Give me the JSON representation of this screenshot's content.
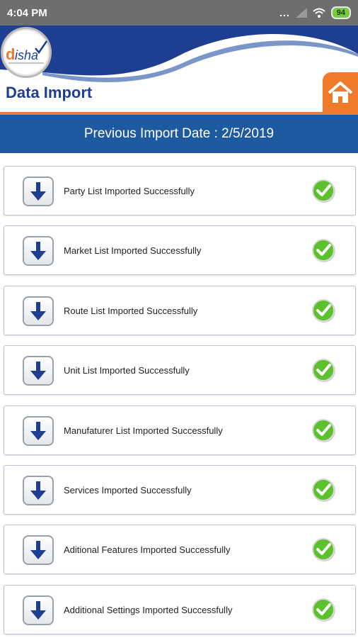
{
  "status_bar": {
    "time": "4:04 PM",
    "dots": "...",
    "battery": "94"
  },
  "header": {
    "logo_text": "disha",
    "title": "Data Import"
  },
  "banner": {
    "text": "Previous Import Date : 2/5/2019"
  },
  "imports": [
    {
      "label": "Party List Imported Successfully"
    },
    {
      "label": "Market List Imported Successfully"
    },
    {
      "label": "Route List Imported Successfully"
    },
    {
      "label": "Unit List Imported Successfully"
    },
    {
      "label": "Manufaturer List Imported Successfully"
    },
    {
      "label": "Services Imported Successfully"
    },
    {
      "label": "Aditional Features Imported Successfully"
    },
    {
      "label": "Additional Settings Imported Successfully"
    }
  ],
  "colors": {
    "header_blue": "#1e3f91",
    "banner_blue": "#1e5aa0",
    "accent_orange": "#f07a2b",
    "success_green": "#5cc22b"
  }
}
